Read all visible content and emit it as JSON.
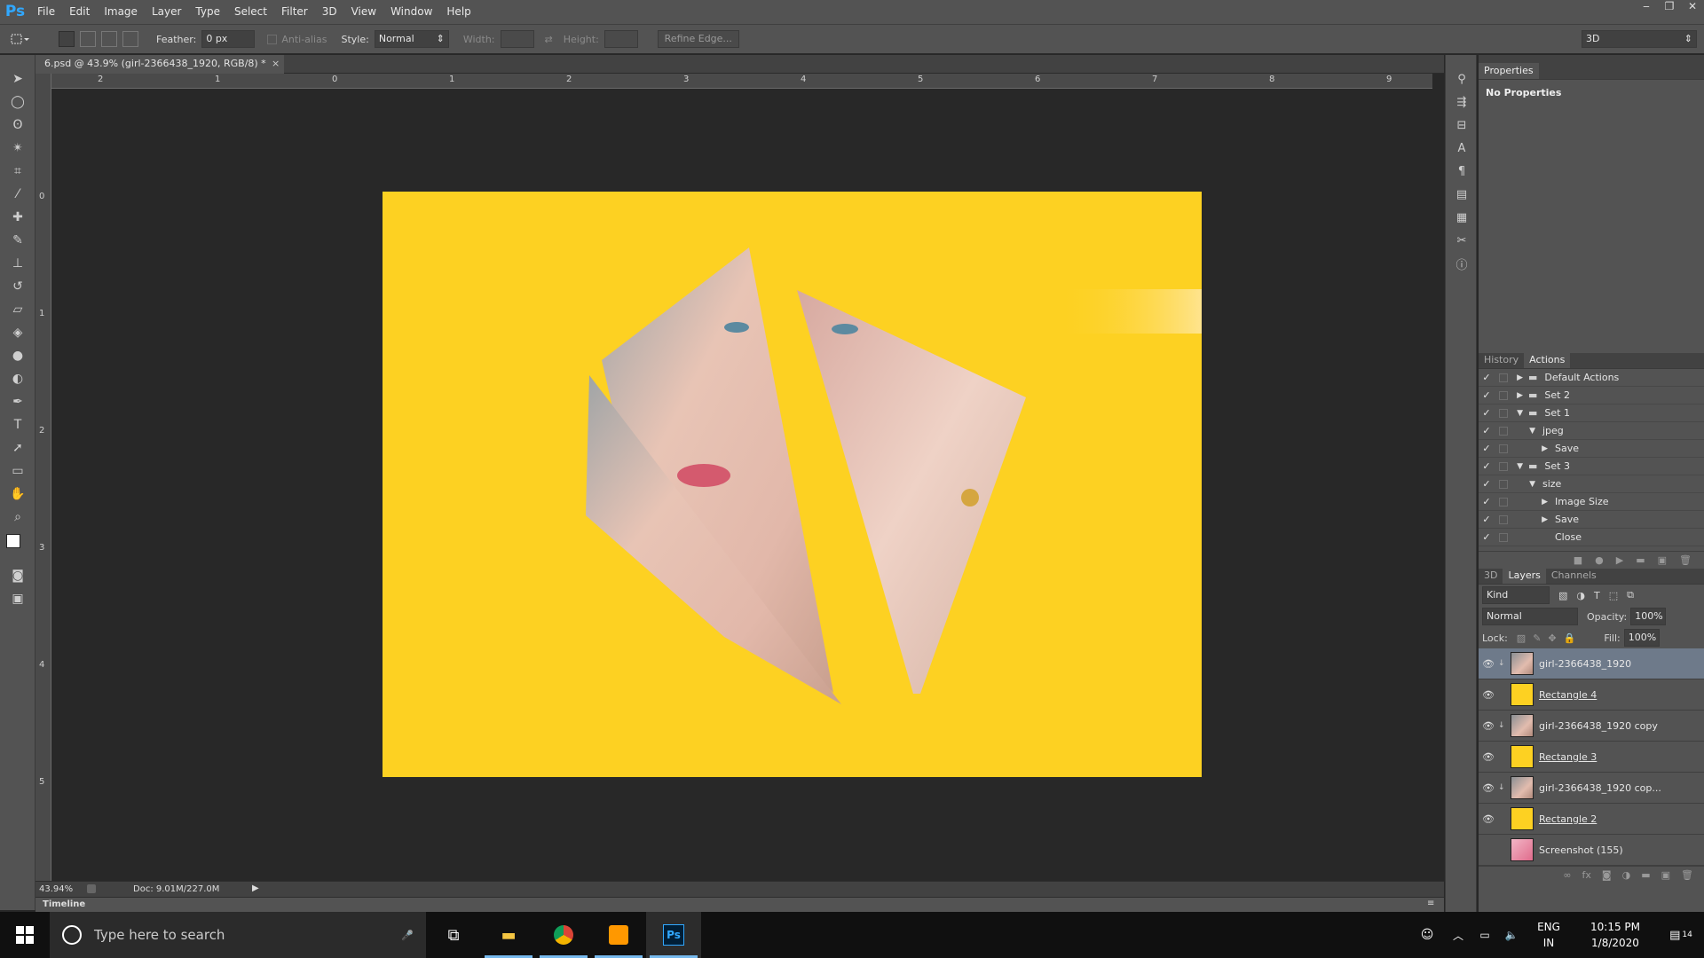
{
  "app": {
    "logo": "Ps"
  },
  "menu": [
    "File",
    "Edit",
    "Image",
    "Layer",
    "Type",
    "Select",
    "Filter",
    "3D",
    "View",
    "Window",
    "Help"
  ],
  "window_controls": [
    "‒",
    "❐",
    "✕"
  ],
  "options": {
    "feather_label": "Feather:",
    "feather_value": "0 px",
    "antialias_label": "Anti-alias",
    "style_label": "Style:",
    "style_value": "Normal",
    "width_label": "Width:",
    "height_label": "Height:",
    "refine_label": "Refine Edge...",
    "workspace_value": "3D"
  },
  "document": {
    "tab_title": "6.psd @ 43.9% (girl-2366438_1920, RGB/8) *",
    "close": "×"
  },
  "ruler": {
    "h": [
      "2",
      "1",
      "0",
      "1",
      "2",
      "3",
      "4",
      "5",
      "6",
      "7",
      "8",
      "9"
    ],
    "v": [
      "0",
      "1",
      "2",
      "3",
      "4",
      "5"
    ]
  },
  "status": {
    "zoom": "43.94%",
    "doc": "Doc: 9.01M/227.0M"
  },
  "timeline": {
    "label": "Timeline"
  },
  "properties": {
    "tab": "Properties",
    "content": "No Properties"
  },
  "actions_panel": {
    "tabs": [
      "History",
      "Actions"
    ],
    "rows": [
      {
        "label": "Default Actions",
        "indent": 0,
        "arrow": "▶",
        "folder": true
      },
      {
        "label": "Set 2",
        "indent": 0,
        "arrow": "▶",
        "folder": true
      },
      {
        "label": "Set 1",
        "indent": 0,
        "arrow": "▼",
        "folder": true
      },
      {
        "label": "jpeg",
        "indent": 1,
        "arrow": "▼",
        "folder": false
      },
      {
        "label": "Save",
        "indent": 2,
        "arrow": "▶",
        "folder": false
      },
      {
        "label": "Set 3",
        "indent": 0,
        "arrow": "▼",
        "folder": true
      },
      {
        "label": "size",
        "indent": 1,
        "arrow": "▼",
        "folder": false
      },
      {
        "label": "Image Size",
        "indent": 2,
        "arrow": "▶",
        "folder": false
      },
      {
        "label": "Save",
        "indent": 2,
        "arrow": "▶",
        "folder": false
      },
      {
        "label": "Close",
        "indent": 2,
        "arrow": "",
        "folder": false
      }
    ]
  },
  "layers_panel": {
    "tabs": [
      "3D",
      "Layers",
      "Channels"
    ],
    "kind": "Kind",
    "blend": "Normal",
    "opacity_label": "Opacity:",
    "opacity": "100%",
    "lock_label": "Lock:",
    "fill_label": "Fill:",
    "fill": "100%",
    "layers": [
      {
        "name": "girl-2366438_1920",
        "type": "photo",
        "selected": true,
        "visible": true,
        "underline": false
      },
      {
        "name": "Rectangle 4",
        "type": "shape",
        "selected": false,
        "visible": true,
        "underline": true
      },
      {
        "name": "girl-2366438_1920 copy",
        "type": "photo",
        "selected": false,
        "visible": true,
        "underline": false
      },
      {
        "name": "Rectangle 3",
        "type": "shape",
        "selected": false,
        "visible": true,
        "underline": true
      },
      {
        "name": "girl-2366438_1920 cop...",
        "type": "photo",
        "selected": false,
        "visible": true,
        "underline": false
      },
      {
        "name": "Rectangle 2",
        "type": "shape",
        "selected": false,
        "visible": true,
        "underline": true
      },
      {
        "name": "Screenshot (155)",
        "type": "screenshot",
        "selected": false,
        "visible": false,
        "underline": false
      }
    ]
  },
  "taskbar": {
    "search_placeholder": "Type here to search",
    "lang": "ENG",
    "region": "IN",
    "time": "10:15 PM",
    "date": "1/8/2020",
    "notifications": "14"
  },
  "colors": {
    "yellow": "#fdd122",
    "ui": "#535353",
    "canvas": "#282828"
  }
}
